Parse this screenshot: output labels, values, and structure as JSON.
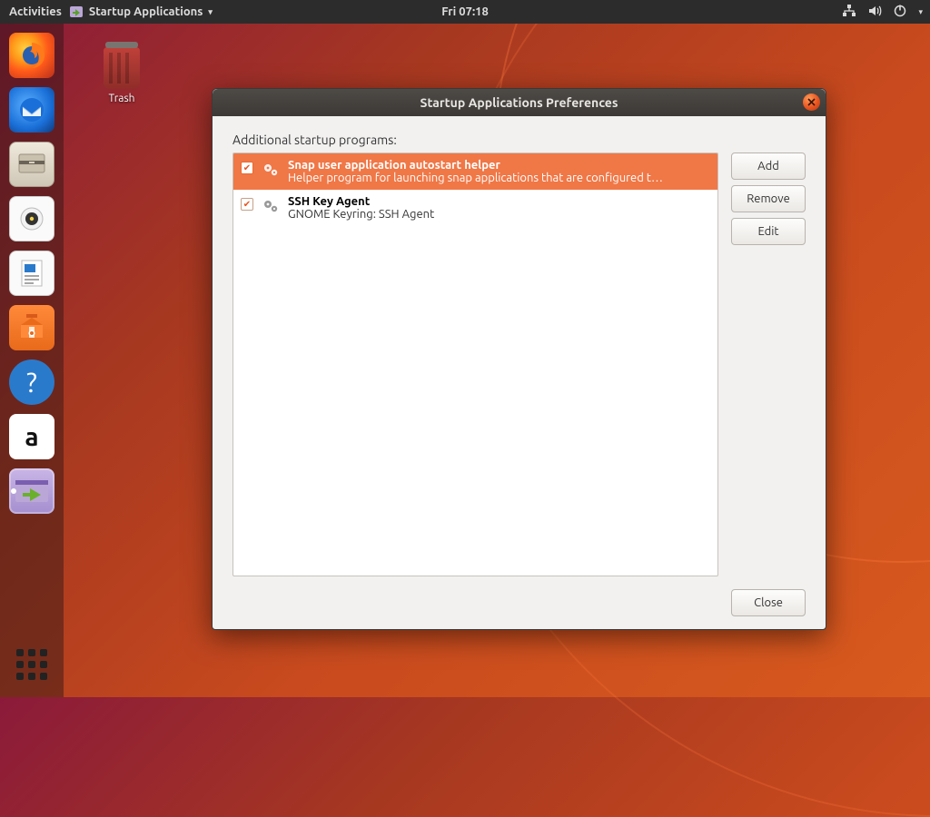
{
  "panel": {
    "activities": "Activities",
    "app_name": "Startup Applications",
    "clock": "Fri 07:18"
  },
  "desktop": {
    "trash_label": "Trash"
  },
  "launcher": {
    "items": [
      "Firefox",
      "Thunderbird",
      "Files",
      "Rhythmbox",
      "LibreOffice Writer",
      "Ubuntu Software",
      "Help",
      "Amazon",
      "Startup Applications"
    ]
  },
  "dialog": {
    "title": "Startup Applications Preferences",
    "section_label": "Additional startup programs:",
    "buttons": {
      "add": "Add",
      "remove": "Remove",
      "edit": "Edit",
      "close": "Close"
    },
    "items": [
      {
        "checked": true,
        "selected": true,
        "title": "Snap user application autostart helper",
        "subtitle": "Helper program for launching snap applications that are configured t…"
      },
      {
        "checked": true,
        "selected": false,
        "title": "SSH Key Agent",
        "subtitle": "GNOME Keyring: SSH Agent"
      }
    ]
  }
}
